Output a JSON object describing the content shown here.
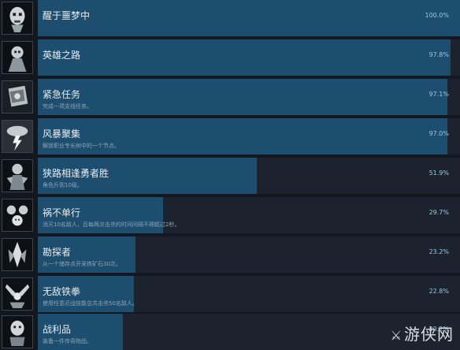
{
  "achievements": [
    {
      "title": "醒于噩梦中",
      "desc": "",
      "percent": "100.0%",
      "fill": 1.0,
      "icon": "skull-face-icon"
    },
    {
      "title": "英雄之路",
      "desc": "",
      "percent": "97.8%",
      "fill": 0.978,
      "icon": "hero-portrait-icon"
    },
    {
      "title": "紧急任务",
      "desc": "完成一项支线任务。",
      "percent": "97.1%",
      "fill": 0.971,
      "icon": "mission-tablet-icon"
    },
    {
      "title": "风暴聚集",
      "desc": "解锁职业专长树中的一个节点。",
      "percent": "97.0%",
      "fill": 0.97,
      "icon": "storm-cloud-icon"
    },
    {
      "title": "狭路相逢勇者胜",
      "desc": "角色升到10级。",
      "percent": "51.9%",
      "fill": 0.519,
      "icon": "warrior-level-icon"
    },
    {
      "title": "祸不单行",
      "desc": "消灭10名敌人，且每两次击杀的时间间隔不得超过2秒。",
      "percent": "29.7%",
      "fill": 0.297,
      "icon": "skull-pile-icon"
    },
    {
      "title": "勘探者",
      "desc": "从一个储存点开采铁矿石30次。",
      "percent": "23.2%",
      "fill": 0.232,
      "icon": "crystal-ore-icon"
    },
    {
      "title": "无敌铁拳",
      "desc": "使用任意近战技能总共击杀50名敌人。",
      "percent": "22.8%",
      "fill": 0.228,
      "icon": "crossed-fists-icon"
    },
    {
      "title": "战利品",
      "desc": "装备一件传奇物品。",
      "percent": "20.2%",
      "fill": 0.202,
      "icon": "loot-skull-icon"
    }
  ],
  "watermark": "游侠网"
}
